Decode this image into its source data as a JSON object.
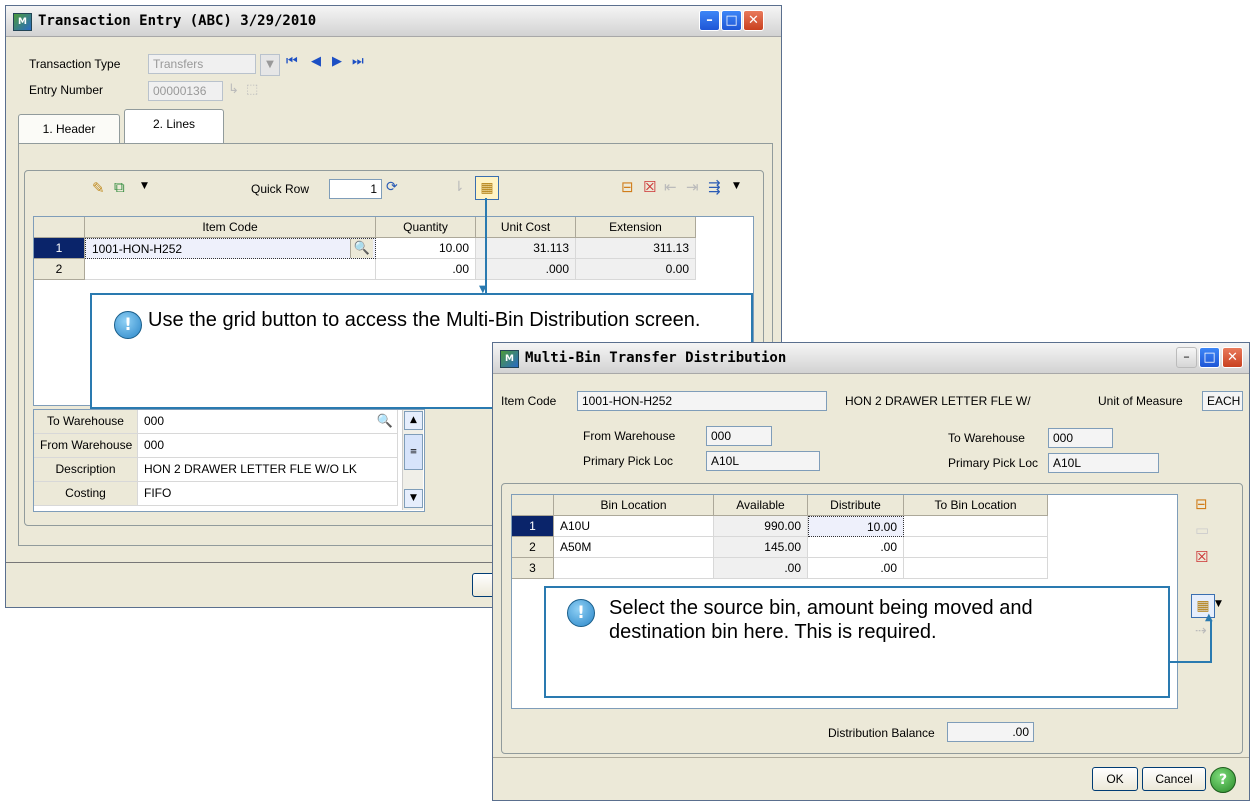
{
  "te": {
    "title": "Transaction Entry (ABC) 3/29/2010",
    "icon_text": "M",
    "transaction_type_label": "Transaction Type",
    "transaction_type_value": "Transfers",
    "entry_number_label": "Entry Number",
    "entry_number_value": "00000136",
    "tab_header": "1. Header",
    "tab_lines": "2. Lines",
    "quick_row_label": "Quick Row",
    "quick_row_value": "1",
    "columns": [
      "Item Code",
      "Quantity",
      "Unit Cost",
      "Extension"
    ],
    "rows": [
      {
        "num": "1",
        "item": "1001-HON-H252",
        "qty": "10.00",
        "cost": "31.113",
        "ext": "311.13"
      },
      {
        "num": "2",
        "item": "",
        "qty": ".00",
        "cost": ".000",
        "ext": "0.00"
      }
    ],
    "details": [
      {
        "label": "To Warehouse",
        "value": "000"
      },
      {
        "label": "From Warehouse",
        "value": "000"
      },
      {
        "label": "Description",
        "value": "HON 2 DRAWER LETTER FLE W/O LK"
      },
      {
        "label": "Costing",
        "value": "FIFO"
      }
    ]
  },
  "callout1": {
    "text": "Use the grid button to access the Multi-Bin Distribution screen.",
    "icon": "!"
  },
  "mb": {
    "title": "Multi-Bin Transfer Distribution",
    "icon_text": "M",
    "item_code_label": "Item Code",
    "item_code_value": "1001-HON-H252",
    "item_desc": "HON 2 DRAWER LETTER FLE W/",
    "uom_label": "Unit of Measure",
    "uom_value": "EACH",
    "from_wh_label": "From Warehouse",
    "from_wh_value": "000",
    "from_pick_label": "Primary Pick Loc",
    "from_pick_value": "A10L",
    "to_wh_label": "To Warehouse",
    "to_wh_value": "000",
    "to_pick_label": "Primary Pick Loc",
    "to_pick_value": "A10L",
    "columns": [
      "Bin Location",
      "Available",
      "Distribute",
      "To Bin Location"
    ],
    "rows": [
      {
        "num": "1",
        "bin": "A10U",
        "avail": "990.00",
        "dist": "10.00",
        "to": ""
      },
      {
        "num": "2",
        "bin": "A50M",
        "avail": "145.00",
        "dist": ".00",
        "to": ""
      },
      {
        "num": "3",
        "bin": "",
        "avail": ".00",
        "dist": ".00",
        "to": ""
      }
    ],
    "balance_label": "Distribution Balance",
    "balance_value": ".00",
    "ok_label": "OK",
    "cancel_label": "Cancel"
  },
  "callout2": {
    "text": "Select the source bin, amount being moved and destination bin here.  This is required.",
    "icon": "!"
  },
  "colors": {
    "callout_border": "#2a7ab0",
    "selected_row": "#0a246a"
  }
}
